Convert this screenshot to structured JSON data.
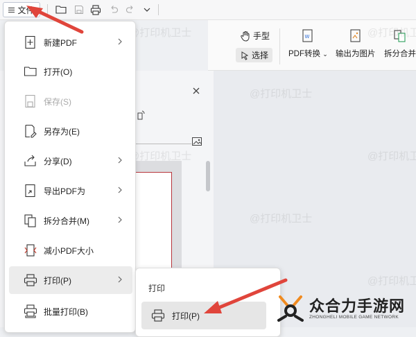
{
  "toolbar": {
    "menu_label": "文件",
    "icons": [
      "open-folder-icon",
      "save-icon",
      "print-icon",
      "undo-icon",
      "redo-icon",
      "chevron-down-icon"
    ]
  },
  "ribbon": {
    "hand_label": "手型",
    "select_label": "选择",
    "pdf_convert_label": "PDF转换",
    "export_image_label": "输出为图片",
    "split_merge_label": "拆分合并"
  },
  "menu": {
    "items": [
      {
        "label": "新建PDF",
        "icon": "new-pdf-icon",
        "submenu": true,
        "enabled": true
      },
      {
        "label": "打开(O)",
        "icon": "open-icon",
        "submenu": false,
        "enabled": true
      },
      {
        "label": "保存(S)",
        "icon": "save-icon",
        "submenu": false,
        "enabled": false
      },
      {
        "label": "另存为(E)",
        "icon": "save-as-icon",
        "submenu": false,
        "enabled": true
      },
      {
        "label": "分享(D)",
        "icon": "share-icon",
        "submenu": true,
        "enabled": true
      },
      {
        "label": "导出PDF为",
        "icon": "export-pdf-icon",
        "submenu": true,
        "enabled": true
      },
      {
        "label": "拆分合并(M)",
        "icon": "split-merge-icon",
        "submenu": true,
        "enabled": true
      },
      {
        "label": "减小PDF大小",
        "icon": "compress-pdf-icon",
        "submenu": false,
        "enabled": true
      },
      {
        "label": "打印(P)",
        "icon": "print-icon",
        "submenu": true,
        "enabled": true,
        "active": true
      },
      {
        "label": "批量打印(B)",
        "icon": "batch-print-icon",
        "submenu": false,
        "enabled": true
      }
    ]
  },
  "submenu": {
    "title": "打印",
    "print_label": "打印(P)"
  },
  "watermark": "@打印机卫士",
  "logo": {
    "main": "众合力手游网",
    "sub": "ZHONGHELI MOBILE GAME NETWORK"
  },
  "colors": {
    "arrow": "#e0453b",
    "doc_border": "#b7343a",
    "logo_orange": "#f08a1f"
  }
}
